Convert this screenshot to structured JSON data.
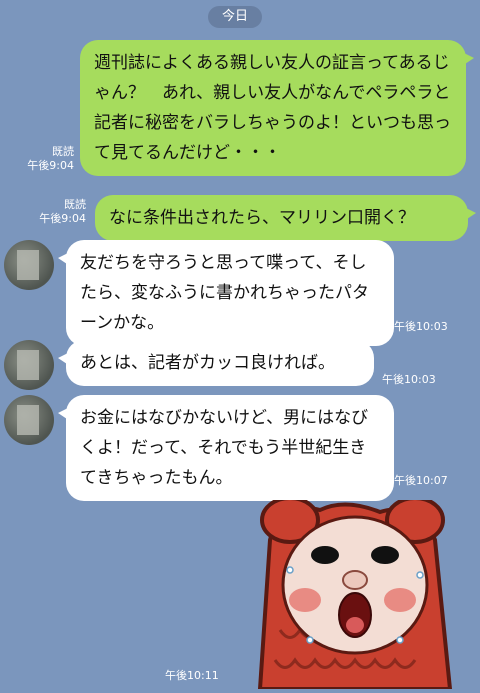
{
  "date_label": "今日",
  "messages": [
    {
      "side": "out",
      "text": "週刊誌によくある親しい友人の証言ってあるじゃん？　あれ、親しい友人がなんでペラペラと記者に秘密をバラしちゃうのよ！といつも思って見てるんだけど・・・",
      "read": "既読",
      "time": "午後9:04"
    },
    {
      "side": "out",
      "text": "なに条件出されたら、マリリン口開く？",
      "read": "既読",
      "time": "午後9:04"
    },
    {
      "side": "in",
      "text": "友だちを守ろうと思って喋って、そしたら、変なふうに書かれちゃったパターンかな。",
      "time": "午後10:03"
    },
    {
      "side": "in",
      "text": "あとは、記者がカッコ良ければ。",
      "time": "午後10:03"
    },
    {
      "side": "in",
      "text": "お金にはなびかないけど、男にはなびくよ！だって、それでもう半世紀生きてきちゃったもん。",
      "time": "午後10:07"
    },
    {
      "side": "in",
      "type": "sticker",
      "sticker": "shocked-character-sticker",
      "time": "午後10:11"
    }
  ]
}
